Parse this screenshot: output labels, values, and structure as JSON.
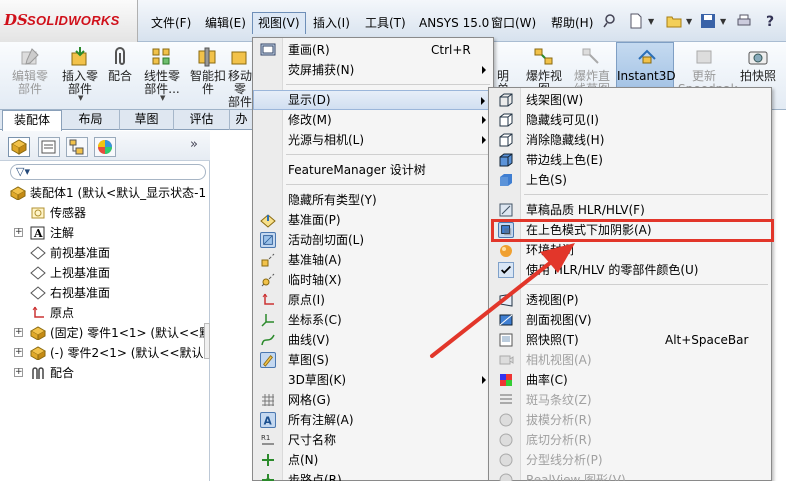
{
  "app": {
    "logo_ds": "DS",
    "logo_text": "SOLIDWORKS"
  },
  "menubar": {
    "items": [
      {
        "label": "文件(F)"
      },
      {
        "label": "编辑(E)"
      },
      {
        "label": "视图(V)"
      },
      {
        "label": "插入(I)"
      },
      {
        "label": "工具(T)"
      },
      {
        "label": "ANSYS 15.0"
      },
      {
        "label": "窗口(W)"
      },
      {
        "label": "帮助(H)"
      }
    ],
    "icons": [
      "pin-icon",
      "new-document-icon",
      "open-folder-icon",
      "save-icon",
      "print-icon",
      "help-icon"
    ]
  },
  "toolbar": {
    "buttons": [
      {
        "label": "编辑零\n部件"
      },
      {
        "label": "插入零\n部件"
      },
      {
        "label": "配合"
      },
      {
        "label": "线性零\n部件..."
      },
      {
        "label": "智能扣\n件"
      },
      {
        "label": "移动零\n部件"
      },
      {
        "label": "爆炸视\n图"
      },
      {
        "label": "爆炸直\n线草图"
      },
      {
        "label": "Instant3D"
      },
      {
        "label": "更新\nSpeedpak"
      },
      {
        "label": "拍快照"
      }
    ],
    "partial_label": "明\n单"
  },
  "tabs": [
    {
      "label": "装配体"
    },
    {
      "label": "布局"
    },
    {
      "label": "草图"
    },
    {
      "label": "评估"
    },
    {
      "label": "办"
    }
  ],
  "feature_manager": {
    "more": "»",
    "filter": "▽▾",
    "tree": [
      {
        "label": "装配体1 (默认<默认_显示状态-1"
      },
      {
        "label": "传感器"
      },
      {
        "label": "注解"
      },
      {
        "label": "前视基准面"
      },
      {
        "label": "上视基准面"
      },
      {
        "label": "右视基准面"
      },
      {
        "label": "原点"
      },
      {
        "label": "(固定) 零件1<1> (默认<<默"
      },
      {
        "label": "(-) 零件2<1> (默认<<默认>"
      },
      {
        "label": "配合"
      }
    ]
  },
  "view_menu": {
    "items": [
      {
        "label": "重画(R)",
        "shortcut": "Ctrl+R"
      },
      {
        "label": "荧屏捕获(N)"
      },
      {
        "label": "显示(D)"
      },
      {
        "label": "修改(M)"
      },
      {
        "label": "光源与相机(L)"
      },
      {
        "label": "FeatureManager 设计树"
      },
      {
        "label": "隐藏所有类型(Y)"
      },
      {
        "label": "基准面(P)"
      },
      {
        "label": "活动剖切面(L)"
      },
      {
        "label": "基准轴(A)"
      },
      {
        "label": "临时轴(X)"
      },
      {
        "label": "原点(I)"
      },
      {
        "label": "坐标系(C)"
      },
      {
        "label": "曲线(V)"
      },
      {
        "label": "草图(S)"
      },
      {
        "label": "3D草图(K)"
      },
      {
        "label": "网格(G)"
      },
      {
        "label": "所有注解(A)"
      },
      {
        "label": "尺寸名称"
      },
      {
        "label": "点(N)"
      },
      {
        "label": "步路点(R)"
      }
    ]
  },
  "display_submenu": {
    "items": [
      {
        "label": "线架图(W)"
      },
      {
        "label": "隐藏线可见(I)"
      },
      {
        "label": "消除隐藏线(H)"
      },
      {
        "label": "带边线上色(E)"
      },
      {
        "label": "上色(S)"
      },
      {
        "label": "草稿品质 HLR/HLV(F)"
      },
      {
        "label": "在上色模式下加阴影(A)"
      },
      {
        "label": "环境封闭"
      },
      {
        "label": "使用 HLR/HLV 的零部件颜色(U)"
      },
      {
        "label": "透视图(P)"
      },
      {
        "label": "剖面视图(V)"
      },
      {
        "label": "照快照(T)",
        "shortcut": "Alt+SpaceBar"
      },
      {
        "label": "相机视图(A)"
      },
      {
        "label": "曲率(C)"
      },
      {
        "label": "斑马条纹(Z)"
      },
      {
        "label": "拔模分析(R)"
      },
      {
        "label": "底切分析(R)"
      },
      {
        "label": "分型线分析(P)"
      },
      {
        "label": "RealView 图形(V)"
      }
    ]
  },
  "colors": {
    "highlight": "#e2362a",
    "brand": "#d0101a"
  }
}
